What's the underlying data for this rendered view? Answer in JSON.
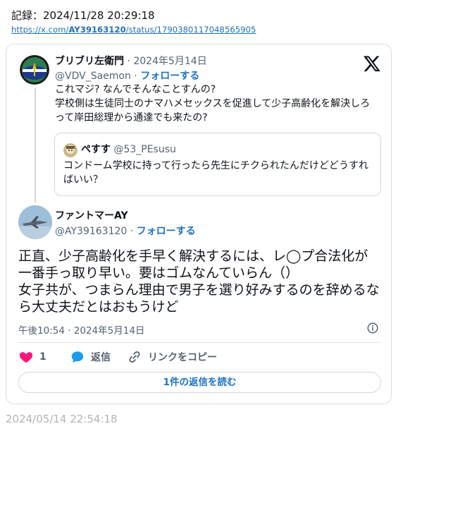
{
  "record": {
    "text": "記録：2024/11/28 20:29:18"
  },
  "link": {
    "prefix": "https://x.com/",
    "user": "AY39163120",
    "suffix": "/status/1790380117048565905"
  },
  "quoted": {
    "name": "ブリブリ左衛門",
    "date": " · 2024年5月14日",
    "handle": "@VDV_Saemon",
    "sep": " · ",
    "follow": "フォローする",
    "text": "これマジ? なんでそんなことすんの?\n学校側は生徒同士のナマハメセックスを促進して少子高齢化を解決しろって岸田総理から通達でも来たの?"
  },
  "inner": {
    "name": "ぺすす",
    "handle": " @53_PEsusu",
    "text": "コンドーム学校に持って行ったら先生にチクられたんだけどどうすればいい？"
  },
  "main": {
    "name": "ファントマーAY",
    "handle": "@AY39163120",
    "sep": " · ",
    "follow": "フォローする",
    "text": "正直、少子高齢化を手早く解決するには、レ◯プ合法化が一番手っ取り早い。要はゴムなんていらん（）\n女子共が、つまらん理由で男子を選り好みするのを辞めるなら大丈夫だとはおもうけど",
    "time": "午後10:54 · 2024年5月14日"
  },
  "actions": {
    "likes": "1",
    "reply": "返信",
    "copy": "リンクをコピー"
  },
  "read_replies": "1件の返信を読む",
  "footer": "2024/05/14 22:54:18",
  "colors": {
    "accent": "#1d72c3",
    "heart": "#f91880",
    "reply": "#1d9bf0",
    "muted": "#536471"
  },
  "icons": [
    "x-logo-icon",
    "info-icon",
    "heart-icon",
    "reply-icon",
    "link-icon"
  ]
}
